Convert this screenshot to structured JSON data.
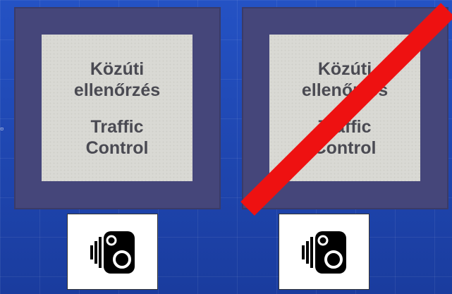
{
  "slide": {
    "bullet": "▫"
  },
  "signs": [
    {
      "id": "traffic-control",
      "line1": "Közúti",
      "line2": "ellenőrzés",
      "line3": "Traffic",
      "line4": "Control",
      "crossed": false
    },
    {
      "id": "traffic-control-end",
      "line1": "Közúti",
      "line2": "ellenőrzés",
      "line3": "Traffic",
      "line4": "Control",
      "crossed": true
    }
  ],
  "camera_icons": [
    {
      "icon": "speed-camera-icon"
    },
    {
      "icon": "speed-camera-icon"
    }
  ],
  "colors": {
    "background": "#1c3fa8",
    "sign_border": "#45467a",
    "sign_panel": "#d9d9d4",
    "sign_text": "#4a4a52",
    "strike": "#ee1111"
  }
}
